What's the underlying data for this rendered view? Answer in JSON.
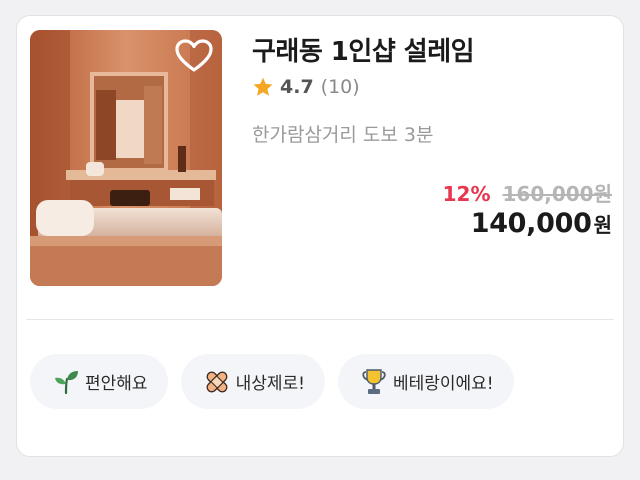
{
  "listing": {
    "title": "구래동 1인샵 설레임",
    "rating": {
      "score": "4.7",
      "count": "(10)"
    },
    "location": "한가람삼거리 도보 3분",
    "price": {
      "discount": "12%",
      "original": "160,000원",
      "current_amount": "140,000",
      "currency_unit": "원"
    },
    "icons": {
      "favorite": "heart-outline-icon",
      "rating": "star-icon"
    }
  },
  "tags": [
    {
      "label": "편안해요",
      "icon": "sprout-icon"
    },
    {
      "label": "내상제로!",
      "icon": "bandage-icon"
    },
    {
      "label": "베테랑이에요!",
      "icon": "trophy-icon"
    }
  ],
  "colors": {
    "discount": "#e8364f",
    "star": "#f5a623",
    "tag_background": "#f4f5f8"
  }
}
